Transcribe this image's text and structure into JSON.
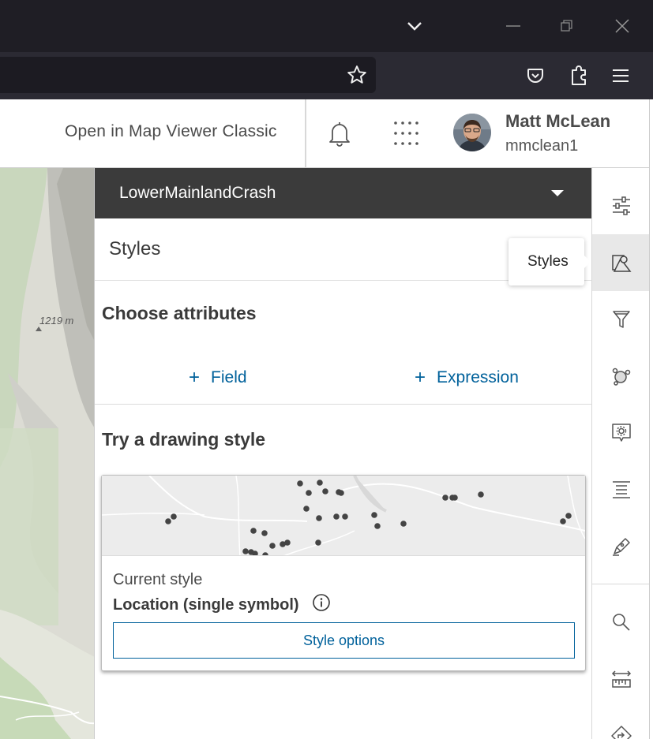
{
  "header": {
    "open_classic": "Open in Map Viewer Classic",
    "user_name": "Matt McLean",
    "user_id": "mmclean1"
  },
  "map": {
    "elevation_label": "1219 m"
  },
  "panel": {
    "layer_name": "LowerMainlandCrash",
    "title": "Styles",
    "choose_attributes": "Choose attributes",
    "field_button": "Field",
    "expression_button": "Expression",
    "drawing_style_title": "Try a drawing style",
    "current_style_label": "Current style",
    "current_style_value": "Location (single symbol)",
    "style_options_button": "Style options"
  },
  "tooltip": {
    "text": "Styles"
  },
  "rail": {
    "items": [
      "properties-icon",
      "styles-icon",
      "filter-icon",
      "effects-icon",
      "configure-popups-icon",
      "labels-icon",
      "sketch-icon",
      "search-icon",
      "measurement-icon",
      "directions-icon"
    ],
    "active": "styles-icon"
  },
  "colors": {
    "accent": "#00619b",
    "layer_bar": "#3b3b3b",
    "titlebar": "#1f1e25",
    "toolbar": "#2b2a33"
  }
}
